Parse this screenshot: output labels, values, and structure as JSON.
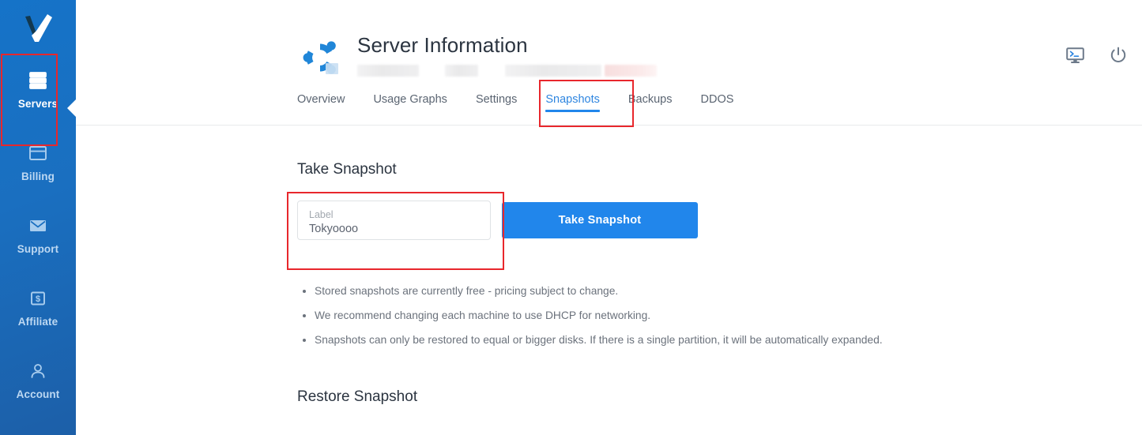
{
  "sidebar": {
    "brand": {
      "name": "vultr-check-logo"
    },
    "items": [
      {
        "label": "Servers",
        "icon": "servers-icon",
        "active": true
      },
      {
        "label": "Billing",
        "icon": "credit-card-icon",
        "active": false
      },
      {
        "label": "Support",
        "icon": "envelope-icon",
        "active": false
      },
      {
        "label": "Affiliate",
        "icon": "dollar-box-icon",
        "active": false
      },
      {
        "label": "Account",
        "icon": "user-icon",
        "active": false
      }
    ],
    "active_color": "#ffffff",
    "inactive_color": "#bdd8f2",
    "background": "#1a6fc0"
  },
  "header": {
    "title": "Server Information",
    "os_logo": "ubuntu-logo",
    "redacted_count": 4,
    "console_icon": "console-monitor-icon",
    "power_icon": "power-icon"
  },
  "tabs": [
    {
      "label": "Overview",
      "active": false
    },
    {
      "label": "Usage Graphs",
      "active": false
    },
    {
      "label": "Settings",
      "active": false
    },
    {
      "label": "Snapshots",
      "active": true
    },
    {
      "label": "Backups",
      "active": false
    },
    {
      "label": "DDOS",
      "active": false
    }
  ],
  "take_snapshot": {
    "heading": "Take Snapshot",
    "label_field": {
      "label": "Label",
      "value": "Tokyoooo",
      "placeholder": "Label"
    },
    "button_label": "Take Snapshot",
    "button_color": "#2186eb"
  },
  "notes": [
    "Stored snapshots are currently free - pricing subject to change.",
    "We recommend changing each machine to use DHCP for networking.",
    "Snapshots can only be restored to equal or bigger disks. If there is a single partition, it will be automatically expanded."
  ],
  "restore_snapshot": {
    "heading": "Restore Snapshot"
  },
  "annotations": {
    "color": "#e8272c",
    "boxes": [
      "servers-nav-item",
      "snapshots-tab",
      "label-input-area"
    ]
  }
}
